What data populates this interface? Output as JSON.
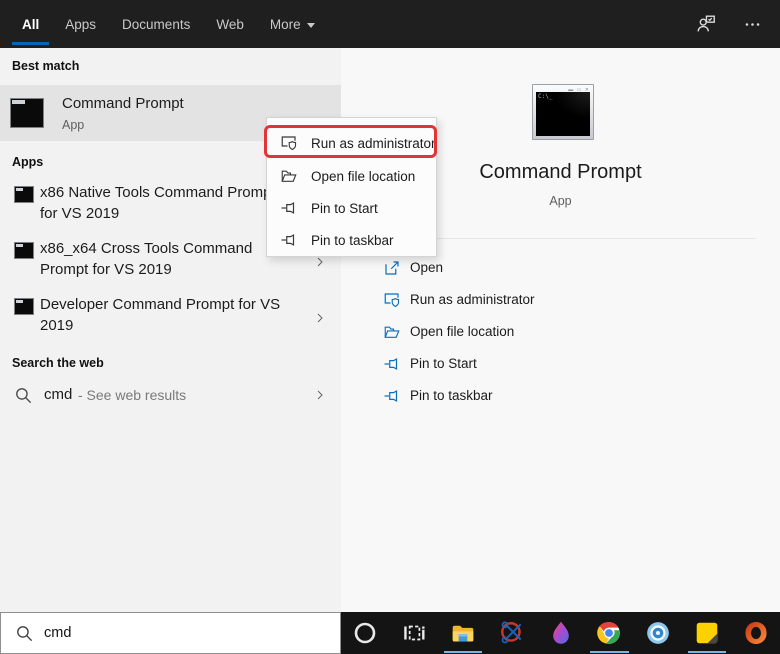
{
  "topbar": {
    "tabs": [
      {
        "label": "All",
        "active": true
      },
      {
        "label": "Apps",
        "active": false
      },
      {
        "label": "Documents",
        "active": false
      },
      {
        "label": "Web",
        "active": false
      },
      {
        "label": "More",
        "active": false,
        "has_dropdown": true
      }
    ],
    "icons": [
      "feedback-icon",
      "ellipsis-icon"
    ]
  },
  "left_panel": {
    "best_match": {
      "header": "Best match",
      "title": "Command Prompt",
      "subtitle": "App"
    },
    "apps": {
      "header": "Apps",
      "items": [
        {
          "label": "x86 Native Tools Command Prompt for VS 2019",
          "icon": "command-prompt-icon"
        },
        {
          "label": "x86_x64 Cross Tools Command Prompt for VS 2019",
          "icon": "command-prompt-icon"
        },
        {
          "label": "Developer Command Prompt for VS 2019",
          "icon": "command-prompt-icon"
        }
      ]
    },
    "web": {
      "header": "Search the web",
      "query": "cmd",
      "suffix": "- See web results"
    }
  },
  "context_menu": {
    "items": [
      {
        "label": "Run as administrator",
        "icon": "run-as-admin-icon",
        "annotated": true
      },
      {
        "label": "Open file location",
        "icon": "open-file-location-icon",
        "annotated": false
      },
      {
        "label": "Pin to Start",
        "icon": "pin-icon",
        "annotated": false
      },
      {
        "label": "Pin to taskbar",
        "icon": "pin-icon",
        "annotated": false
      }
    ]
  },
  "preview": {
    "title": "Command Prompt",
    "subtitle": "App",
    "actions": [
      {
        "label": "Open",
        "icon": "open-icon"
      },
      {
        "label": "Run as administrator",
        "icon": "run-as-admin-icon"
      },
      {
        "label": "Open file location",
        "icon": "open-file-location-icon"
      },
      {
        "label": "Pin to Start",
        "icon": "pin-icon"
      },
      {
        "label": "Pin to taskbar",
        "icon": "pin-icon"
      }
    ]
  },
  "search_box": {
    "value": "cmd"
  },
  "taskbar": {
    "icons": [
      {
        "name": "cortana",
        "running": false
      },
      {
        "name": "task-view",
        "running": false
      },
      {
        "name": "file-explorer",
        "running": true
      },
      {
        "name": "snipping-tool",
        "running": false
      },
      {
        "name": "paint-3d",
        "running": false
      },
      {
        "name": "chrome",
        "running": true
      },
      {
        "name": "target-app",
        "running": false
      },
      {
        "name": "sticky-notes",
        "running": true
      },
      {
        "name": "office",
        "running": false
      }
    ]
  },
  "colors": {
    "accent": "#0067b8",
    "annotation_red": "#e13438",
    "running_underline": "#75b6e7",
    "topbar_bg": "#1f1f1f",
    "taskbar_bg": "#141414",
    "action_icon_blue": "#0b6dbd"
  }
}
